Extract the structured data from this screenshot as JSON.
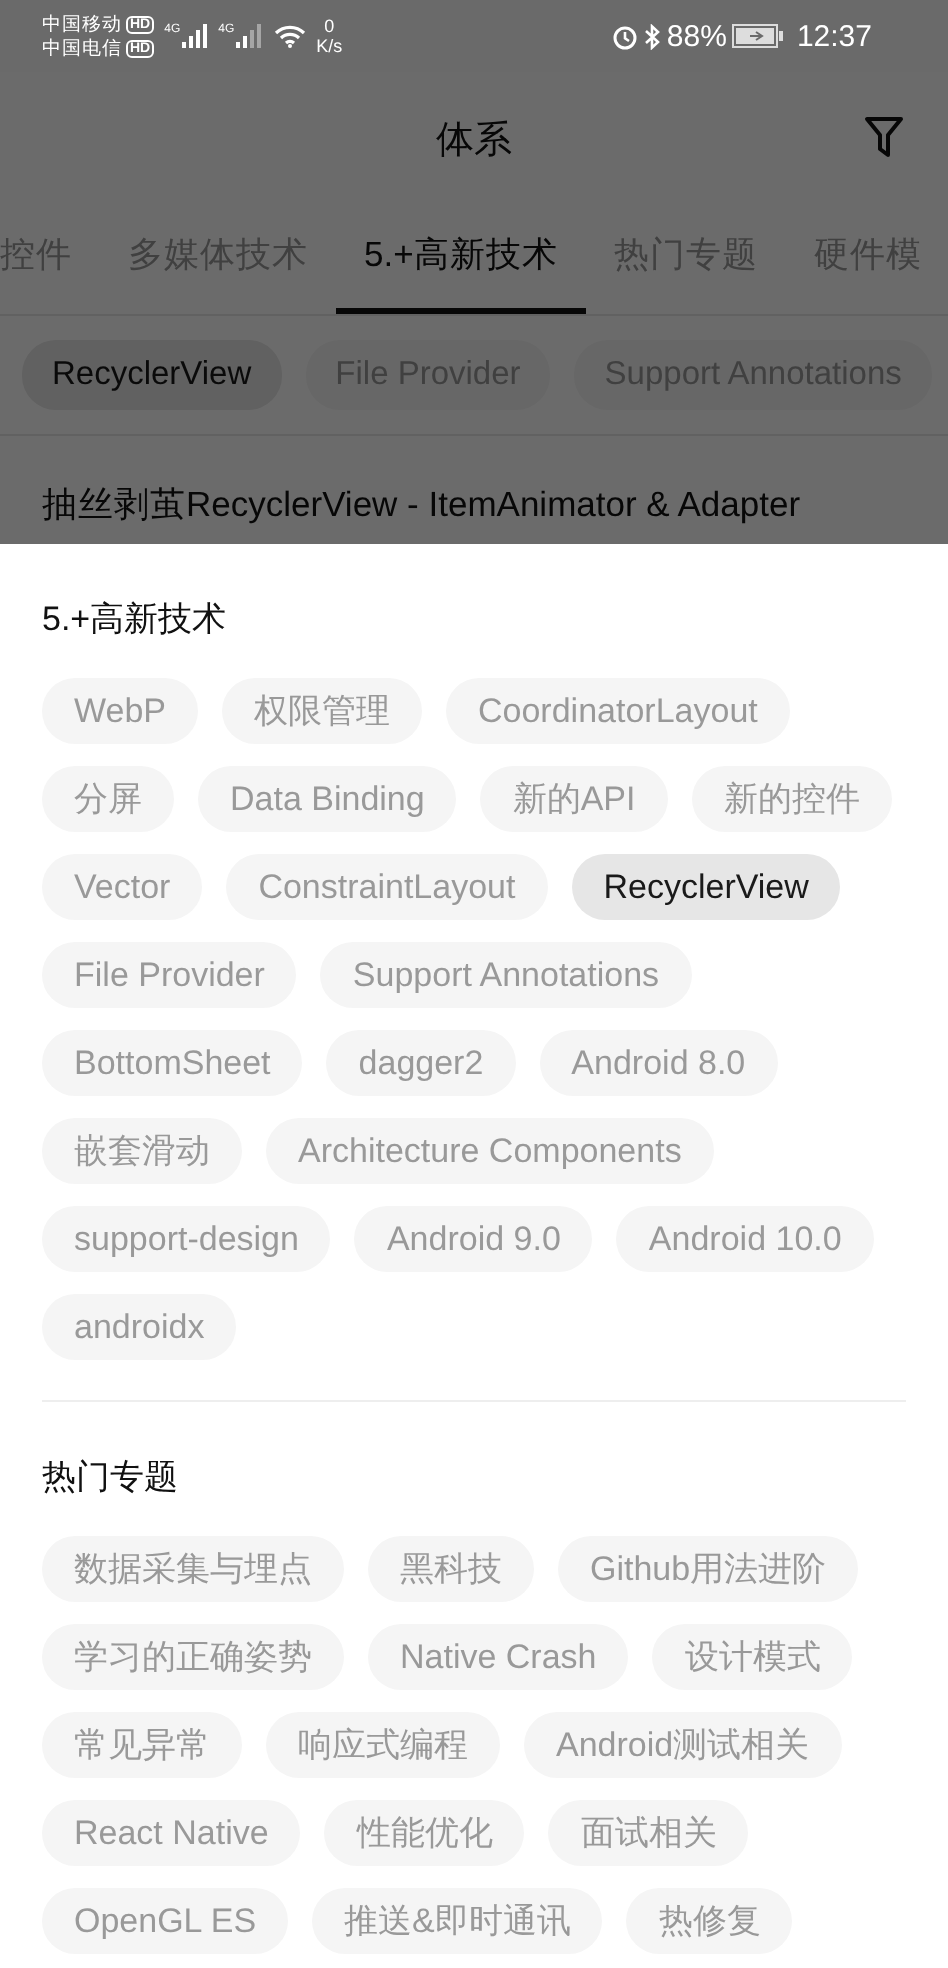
{
  "status_bar": {
    "carriers": [
      {
        "name": "中国移动",
        "badge": "HD",
        "network": "4G"
      },
      {
        "name": "中国电信",
        "badge": "HD",
        "network": "4G"
      }
    ],
    "speed_value": "0",
    "speed_unit": "K/s",
    "battery": "88%",
    "time": "12:37"
  },
  "app_bar": {
    "title": "体系"
  },
  "tabs": [
    {
      "label": "控件",
      "selected": false
    },
    {
      "label": "多媒体技术",
      "selected": false
    },
    {
      "label": "5.+高新技术",
      "selected": true
    },
    {
      "label": "热门专题",
      "selected": false
    },
    {
      "label": "硬件模",
      "selected": false
    }
  ],
  "chips": [
    {
      "label": "RecyclerView",
      "selected": true
    },
    {
      "label": "File Provider",
      "selected": false
    },
    {
      "label": "Support Annotations",
      "selected": false
    }
  ],
  "article_title": "抽丝剥茧RecyclerView - ItemAnimator & Adapter",
  "sheet": {
    "sections": [
      {
        "title": "5.+高新技术",
        "chips": [
          {
            "label": "WebP",
            "selected": false
          },
          {
            "label": "权限管理",
            "selected": false
          },
          {
            "label": "CoordinatorLayout",
            "selected": false
          },
          {
            "label": "分屏",
            "selected": false
          },
          {
            "label": "Data Binding",
            "selected": false
          },
          {
            "label": "新的API",
            "selected": false
          },
          {
            "label": "新的控件",
            "selected": false
          },
          {
            "label": "Vector",
            "selected": false
          },
          {
            "label": "ConstraintLayout",
            "selected": false
          },
          {
            "label": "RecyclerView",
            "selected": true
          },
          {
            "label": "File Provider",
            "selected": false
          },
          {
            "label": "Support Annotations",
            "selected": false
          },
          {
            "label": "BottomSheet",
            "selected": false
          },
          {
            "label": "dagger2",
            "selected": false
          },
          {
            "label": "Android 8.0",
            "selected": false
          },
          {
            "label": "嵌套滑动",
            "selected": false
          },
          {
            "label": "Architecture Components",
            "selected": false
          },
          {
            "label": "support-design",
            "selected": false
          },
          {
            "label": "Android 9.0",
            "selected": false
          },
          {
            "label": "Android 10.0",
            "selected": false
          },
          {
            "label": "androidx",
            "selected": false
          }
        ]
      },
      {
        "title": "热门专题",
        "chips": [
          {
            "label": "数据采集与埋点",
            "selected": false
          },
          {
            "label": "黑科技",
            "selected": false
          },
          {
            "label": "Github用法进阶",
            "selected": false
          },
          {
            "label": "学习的正确姿势",
            "selected": false
          },
          {
            "label": "Native Crash",
            "selected": false
          },
          {
            "label": "设计模式",
            "selected": false
          },
          {
            "label": "常见异常",
            "selected": false
          },
          {
            "label": "响应式编程",
            "selected": false
          },
          {
            "label": "Android测试相关",
            "selected": false
          },
          {
            "label": "React Native",
            "selected": false
          },
          {
            "label": "性能优化",
            "selected": false
          },
          {
            "label": "面试相关",
            "selected": false
          },
          {
            "label": "OpenGL ES",
            "selected": false
          },
          {
            "label": "推送&即时通讯",
            "selected": false
          },
          {
            "label": "热修复",
            "selected": false
          }
        ]
      }
    ]
  }
}
